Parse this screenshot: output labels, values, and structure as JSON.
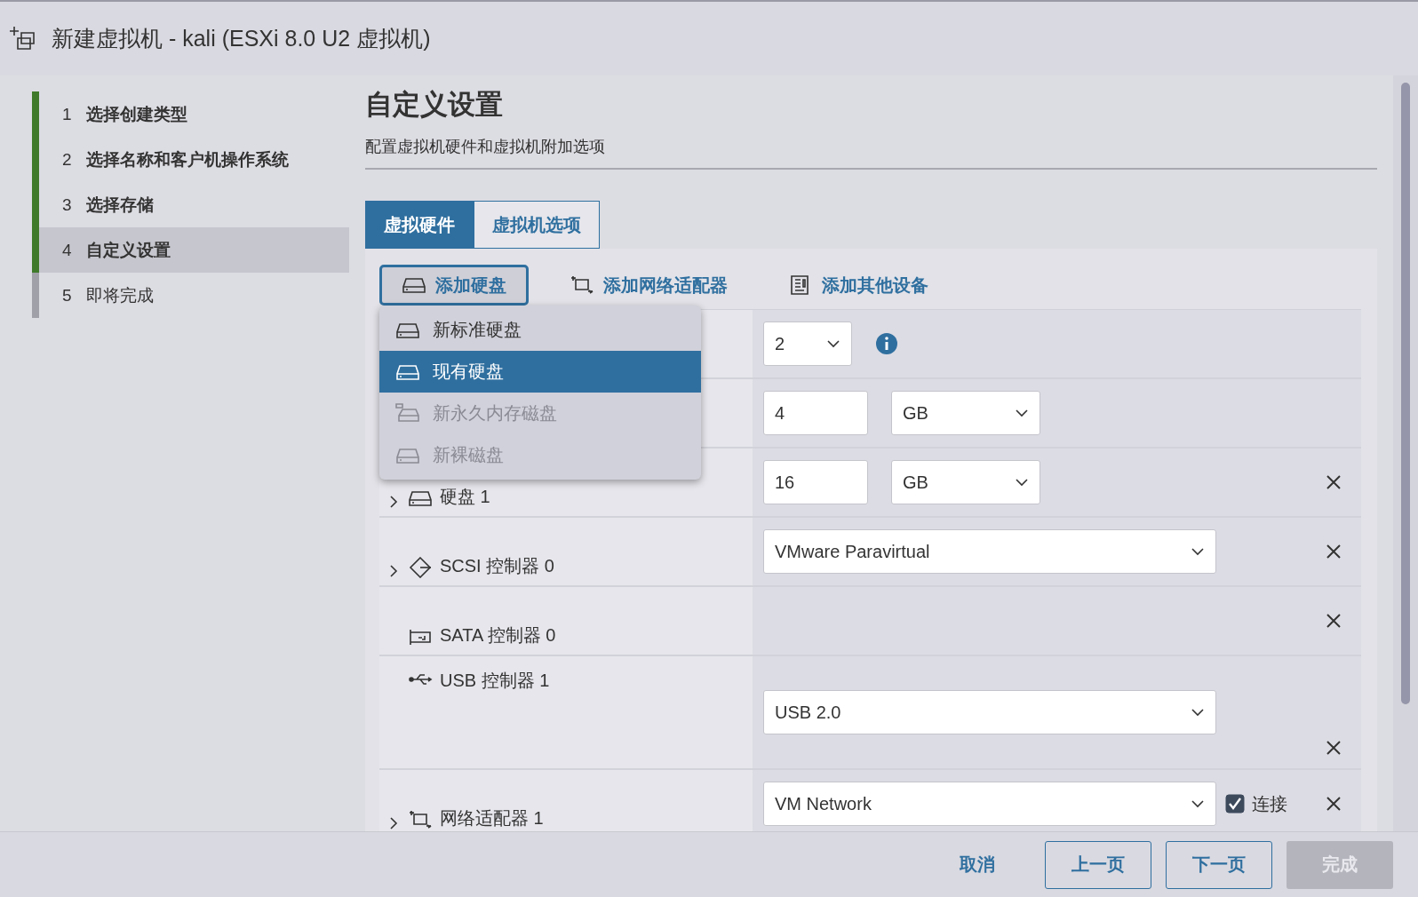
{
  "window": {
    "title": "新建虚拟机 - kali (ESXi 8.0 U2 虚拟机)"
  },
  "steps": [
    {
      "number": "1",
      "label": "选择创建类型",
      "done": true,
      "selected": false
    },
    {
      "number": "2",
      "label": "选择名称和客户机操作系统",
      "done": true,
      "selected": false
    },
    {
      "number": "3",
      "label": "选择存储",
      "done": true,
      "selected": false
    },
    {
      "number": "4",
      "label": "自定义设置",
      "done": true,
      "selected": true
    },
    {
      "number": "5",
      "label": "即将完成",
      "done": false,
      "selected": false
    }
  ],
  "page": {
    "heading": "自定义设置",
    "subtitle": "配置虚拟机硬件和虚拟机附加选项"
  },
  "tabs": [
    {
      "label": "虚拟硬件",
      "selected": true
    },
    {
      "label": "虚拟机选项",
      "selected": false
    }
  ],
  "toolbar": [
    {
      "label": "添加硬盘",
      "kind": "disk",
      "open": true
    },
    {
      "label": "添加网络适配器",
      "kind": "network",
      "open": false
    },
    {
      "label": "添加其他设备",
      "kind": "device",
      "open": false
    }
  ],
  "menu": [
    {
      "label": "新标准硬盘",
      "kind": "disk",
      "selected": false,
      "disabled": false
    },
    {
      "label": "现有硬盘",
      "kind": "disk",
      "selected": true,
      "disabled": false
    },
    {
      "label": "新永久内存磁盘",
      "kind": "pmem",
      "selected": false,
      "disabled": true
    },
    {
      "label": "新裸磁盘",
      "kind": "disk",
      "selected": false,
      "disabled": true
    }
  ],
  "rows": [
    {
      "controls": [
        {
          "kind": "small-select",
          "value": "2"
        },
        {
          "kind": "info"
        }
      ],
      "removable": false
    },
    {
      "controls": [
        {
          "kind": "input",
          "value": "4"
        },
        {
          "kind": "unit-select",
          "value": "GB"
        }
      ],
      "removable": false
    },
    {
      "label": "硬盘 1",
      "kind": "disk",
      "expandable": true,
      "controls": [
        {
          "kind": "input",
          "value": "16"
        },
        {
          "kind": "unit-select",
          "value": "GB"
        }
      ],
      "removable": true
    },
    {
      "label": "SCSI 控制器 0",
      "kind": "scsi",
      "expandable": true,
      "controls": [
        {
          "kind": "wide-select",
          "value": "VMware Paravirtual"
        }
      ],
      "removable": true
    },
    {
      "label": "SATA 控制器 0",
      "kind": "sata",
      "expandable": false,
      "controls": [],
      "removable": true
    },
    {
      "label": "USB 控制器 1",
      "kind": "usb",
      "expandable": false,
      "controls": [
        {
          "kind": "wide-select",
          "value": "USB 2.0"
        }
      ],
      "removable": true
    },
    {
      "label": "网络适配器 1",
      "kind": "network",
      "expandable": true,
      "controls": [
        {
          "kind": "wide-select",
          "value": "VM Network"
        },
        {
          "kind": "checkbox",
          "label": "连接",
          "checked": true
        }
      ],
      "removable": true
    }
  ],
  "footer": [
    {
      "label": "取消",
      "kind": "flat",
      "disabled": false
    },
    {
      "label": "上一页",
      "kind": "outline",
      "disabled": false
    },
    {
      "label": "下一页",
      "kind": "outline",
      "disabled": false
    },
    {
      "label": "完成",
      "kind": "solid",
      "disabled": true
    }
  ]
}
